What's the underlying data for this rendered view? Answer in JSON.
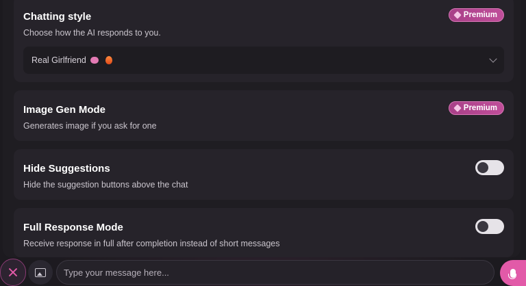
{
  "settings": {
    "chatting_style": {
      "title": "Chatting style",
      "description": "Choose how the AI responds to you.",
      "badge": "Premium",
      "selected_value": "Real Girlfriend"
    },
    "image_gen_mode": {
      "title": "Image Gen Mode",
      "description": "Generates image if you ask for one",
      "badge": "Premium"
    },
    "hide_suggestions": {
      "title": "Hide Suggestions",
      "description": "Hide the suggestion buttons above the chat",
      "enabled": false
    },
    "full_response_mode": {
      "title": "Full Response Mode",
      "description": "Receive response in full after completion instead of short messages",
      "enabled": false
    }
  },
  "composer": {
    "placeholder": "Type your message here...",
    "value": ""
  },
  "icons": {
    "close": "close-icon",
    "image": "image-icon",
    "mic": "microphone-icon",
    "premium": "diamond-icon",
    "chevron": "chevron-down-icon"
  },
  "colors": {
    "accent": "#e25aa8",
    "badge": "#b4478f",
    "card": "#26232a",
    "background": "#1c1a1f"
  }
}
